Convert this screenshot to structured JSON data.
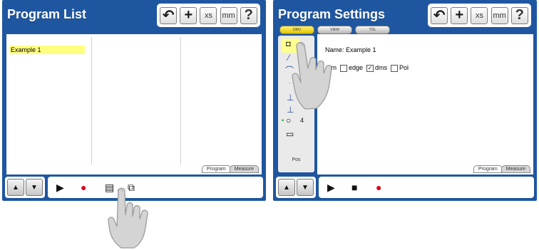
{
  "left": {
    "title": "Program List",
    "toolbar": {
      "undo": "↶",
      "datum": "+",
      "xs": "xs",
      "units": "mm",
      "help": "?"
    },
    "program_items": [
      "Example 1"
    ],
    "bottom_tabs": [
      "Program",
      "Measure"
    ],
    "controls": {
      "up": "▲",
      "down": "▼",
      "run": "▶",
      "record": "●",
      "edit": "▤",
      "copy": "⧉"
    }
  },
  "right": {
    "title": "Program Settings",
    "toolbar": {
      "undo": "↶",
      "datum": "+",
      "xs": "xs",
      "units": "mm",
      "help": "?"
    },
    "mode_tabs": [
      "DRO",
      "VIEW",
      "TOL"
    ],
    "program_name": "Name: Example 1",
    "options": {
      "mm": "mm",
      "edge": "edge",
      "dims": "dms",
      "pol": "Pol"
    },
    "checks": {
      "edge": "",
      "dims": "✓",
      "pol": ""
    },
    "feature_count": "4",
    "side_label": "Pos",
    "bottom_tabs": [
      "Program",
      "Measure"
    ],
    "controls": {
      "up": "▲",
      "down": "▼",
      "run": "▶",
      "stop": "■",
      "record": "●"
    }
  },
  "colors": {
    "panel": "#1f56a0",
    "highlight": "#ffff80",
    "record": "#e0001b"
  },
  "icons": [
    "undo-icon",
    "crosshair-icon",
    "help-icon",
    "play-icon",
    "record-icon",
    "stop-icon",
    "edit-icon",
    "copy-icon",
    "pointing-hand-icon"
  ]
}
